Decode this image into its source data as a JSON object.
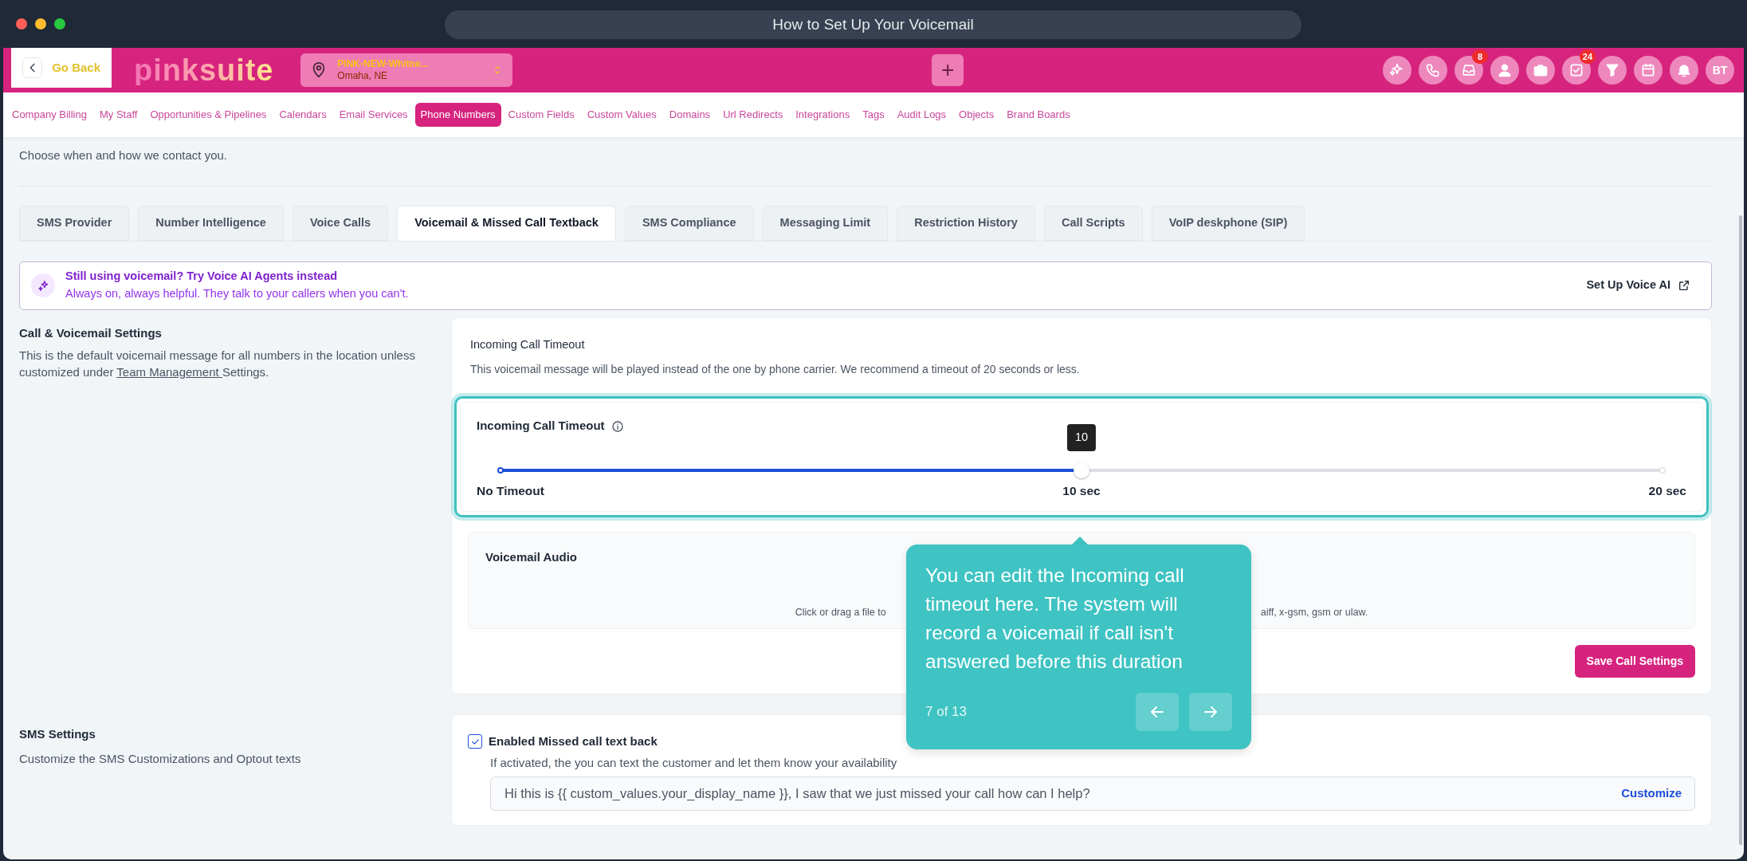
{
  "window": {
    "title": "How to Set Up Your Voicemail"
  },
  "header": {
    "back_label": "Go Back",
    "logo": "pinksuite",
    "location": {
      "name": "PINK-NEW-Whitne...",
      "city": "Omaha, NE"
    },
    "add_label": "+",
    "icons": [
      {
        "kind": "sparkle"
      },
      {
        "kind": "phone"
      },
      {
        "kind": "inbox",
        "badge": "8"
      },
      {
        "kind": "person"
      },
      {
        "kind": "briefcase"
      },
      {
        "kind": "check",
        "badge": "24"
      },
      {
        "kind": "filter"
      },
      {
        "kind": "calendar"
      },
      {
        "kind": "bell"
      }
    ],
    "avatar": "BT"
  },
  "nav": [
    {
      "label": "Company Billing",
      "selected": false
    },
    {
      "label": "My Staff",
      "selected": false
    },
    {
      "label": "Opportunities & Pipelines",
      "selected": false
    },
    {
      "label": "Calendars",
      "selected": false
    },
    {
      "label": "Email Services",
      "selected": false
    },
    {
      "label": "Phone Numbers",
      "selected": true
    },
    {
      "label": "Custom Fields",
      "selected": false
    },
    {
      "label": "Custom Values",
      "selected": false
    },
    {
      "label": "Domains",
      "selected": false
    },
    {
      "label": "Url Redirects",
      "selected": false
    },
    {
      "label": "Integrations",
      "selected": false
    },
    {
      "label": "Tags",
      "selected": false
    },
    {
      "label": "Audit Logs",
      "selected": false
    },
    {
      "label": "Objects",
      "selected": false
    },
    {
      "label": "Brand Boards",
      "selected": false
    }
  ],
  "subtitle": "Choose when and how we contact you.",
  "tabs": [
    {
      "label": "SMS Provider",
      "selected": false
    },
    {
      "label": "Number Intelligence",
      "selected": false
    },
    {
      "label": "Voice Calls",
      "selected": false
    },
    {
      "label": "Voicemail & Missed Call Textback",
      "selected": true
    },
    {
      "label": "SMS Compliance",
      "selected": false
    },
    {
      "label": "Messaging Limit",
      "selected": false
    },
    {
      "label": "Restriction History",
      "selected": false
    },
    {
      "label": "Call Scripts",
      "selected": false
    },
    {
      "label": "VoIP deskphone (SIP)",
      "selected": false
    }
  ],
  "banner": {
    "title": "Still using voicemail? Try Voice AI Agents instead",
    "text": "Always on, always helpful. They talk to your callers when you can't.",
    "button": "Set Up Voice AI"
  },
  "call_settings": {
    "title": "Call & Voicemail Settings",
    "text_before": "This is the default voicemail message for all numbers in the location unless customized under ",
    "link": "Team Management ",
    "text_after": "Settings."
  },
  "timeout_card": {
    "title": "Incoming Call Timeout",
    "description": "This voicemail message will be played instead of the one by phone carrier. We recommend a timeout of 20 seconds or less.",
    "slider": {
      "label": "Incoming Call Timeout",
      "level": 0.5,
      "value_tip": "10",
      "min_label": "No Timeout",
      "mid_label": "10 sec",
      "max_label": "20 sec"
    }
  },
  "voicemail_audio": {
    "title": "Voicemail Audio",
    "hint_start": "Click or drag a file to",
    "hint_end": "aiff, x-gsm, gsm or ulaw."
  },
  "save_button": "Save Call Settings",
  "sms_settings": {
    "title": "SMS Settings",
    "description": "Customize the SMS Customizations and Optout texts",
    "checkbox": {
      "label": "Enabled Missed call text back",
      "checked": true
    },
    "helper": "If activated, the you can text the customer and let them know your availability",
    "message": "Hi this is {{ custom_values.your_display_name }}, I saw that we just missed your call how can I help?",
    "action": "Customize"
  },
  "tour": {
    "text": "You can edit the Incoming call timeout here. The system will record a voicemail if call isn't answered before this duration",
    "step": "7 of 13"
  }
}
